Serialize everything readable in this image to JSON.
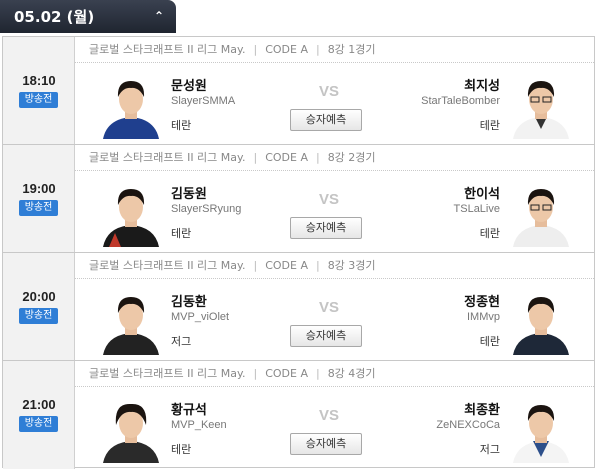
{
  "header": {
    "date": "05.02 (월)"
  },
  "predict_label": "승자예측",
  "vs_label": "VS",
  "matches": [
    {
      "time": "18:10",
      "status": "방송전",
      "league": "글로벌 스타크래프트 II 리그 May.",
      "code": "CODE A",
      "round": "8강 1경기",
      "left": {
        "name": "문성원",
        "id": "SlayerSMMA",
        "race": "테란"
      },
      "right": {
        "name": "최지성",
        "id": "StarTaleBomber",
        "race": "테란"
      }
    },
    {
      "time": "19:00",
      "status": "방송전",
      "league": "글로벌 스타크래프트 II 리그 May.",
      "code": "CODE A",
      "round": "8강 2경기",
      "left": {
        "name": "김동원",
        "id": "SlayerSRyung",
        "race": "테란"
      },
      "right": {
        "name": "한이석",
        "id": "TSLaLive",
        "race": "테란"
      }
    },
    {
      "time": "20:00",
      "status": "방송전",
      "league": "글로벌 스타크래프트 II 리그 May.",
      "code": "CODE A",
      "round": "8강 3경기",
      "left": {
        "name": "김동환",
        "id": "MVP_viOlet",
        "race": "저그"
      },
      "right": {
        "name": "정종현",
        "id": "IMMvp",
        "race": "테란"
      }
    },
    {
      "time": "21:00",
      "status": "방송전",
      "league": "글로벌 스타크래프트 II 리그 May.",
      "code": "CODE A",
      "round": "8강 4경기",
      "left": {
        "name": "황규석",
        "id": "MVP_Keen",
        "race": "테란"
      },
      "right": {
        "name": "최종환",
        "id": "ZeNEXCoCa",
        "race": "저그"
      }
    }
  ]
}
